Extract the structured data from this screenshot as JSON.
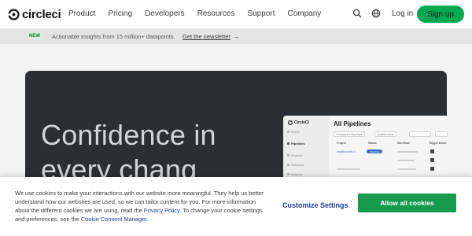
{
  "header": {
    "brand": "circleci",
    "nav": [
      "Product",
      "Pricing",
      "Developers",
      "Resources",
      "Support",
      "Company"
    ],
    "icons": [
      "search-icon",
      "globe-icon"
    ],
    "login_label": "Log in",
    "signup_label": "Sign up"
  },
  "announcement": {
    "badge": "NEW",
    "text": "Actionable insights from 15 million+ datapoints.",
    "link": "Get the newsletter",
    "arrow": "→"
  },
  "hero": {
    "title_line1": "Confidence in",
    "title_line2": "every chang"
  },
  "mockup": {
    "brand": "CircleCI",
    "title": "All Pipelines",
    "sidebar": [
      "Home",
      "Pipelines",
      "Projects",
      "Releases",
      "Insights"
    ],
    "filters": [
      "Everyone's Pipelines",
      "project-name"
    ],
    "columns": [
      "Project",
      "Status",
      "Workflow",
      "Trigger Event"
    ],
    "row_project": "workflow-test-1",
    "row_status": "Running"
  },
  "cookie": {
    "text_part1": "We use cookies to make your interactions with our website more meaningful. They help us better understand how our websites are used, so we can tailor content for you. For more information about the different cookies we are using, read the ",
    "privacy_link": "Privacy Policy",
    "text_part2": ". To change your cookie settings and preferences, see the ",
    "manager_link": "Cookie Consent Manager",
    "text_part3": ".",
    "customize_label": "Customize Settings",
    "allow_label": "Allow all cookies"
  },
  "colors": {
    "brand_green": "#04aa51",
    "hero_bg": "#2b2e33",
    "link_blue": "#1c3f94",
    "allow_green": "#169a4e"
  }
}
